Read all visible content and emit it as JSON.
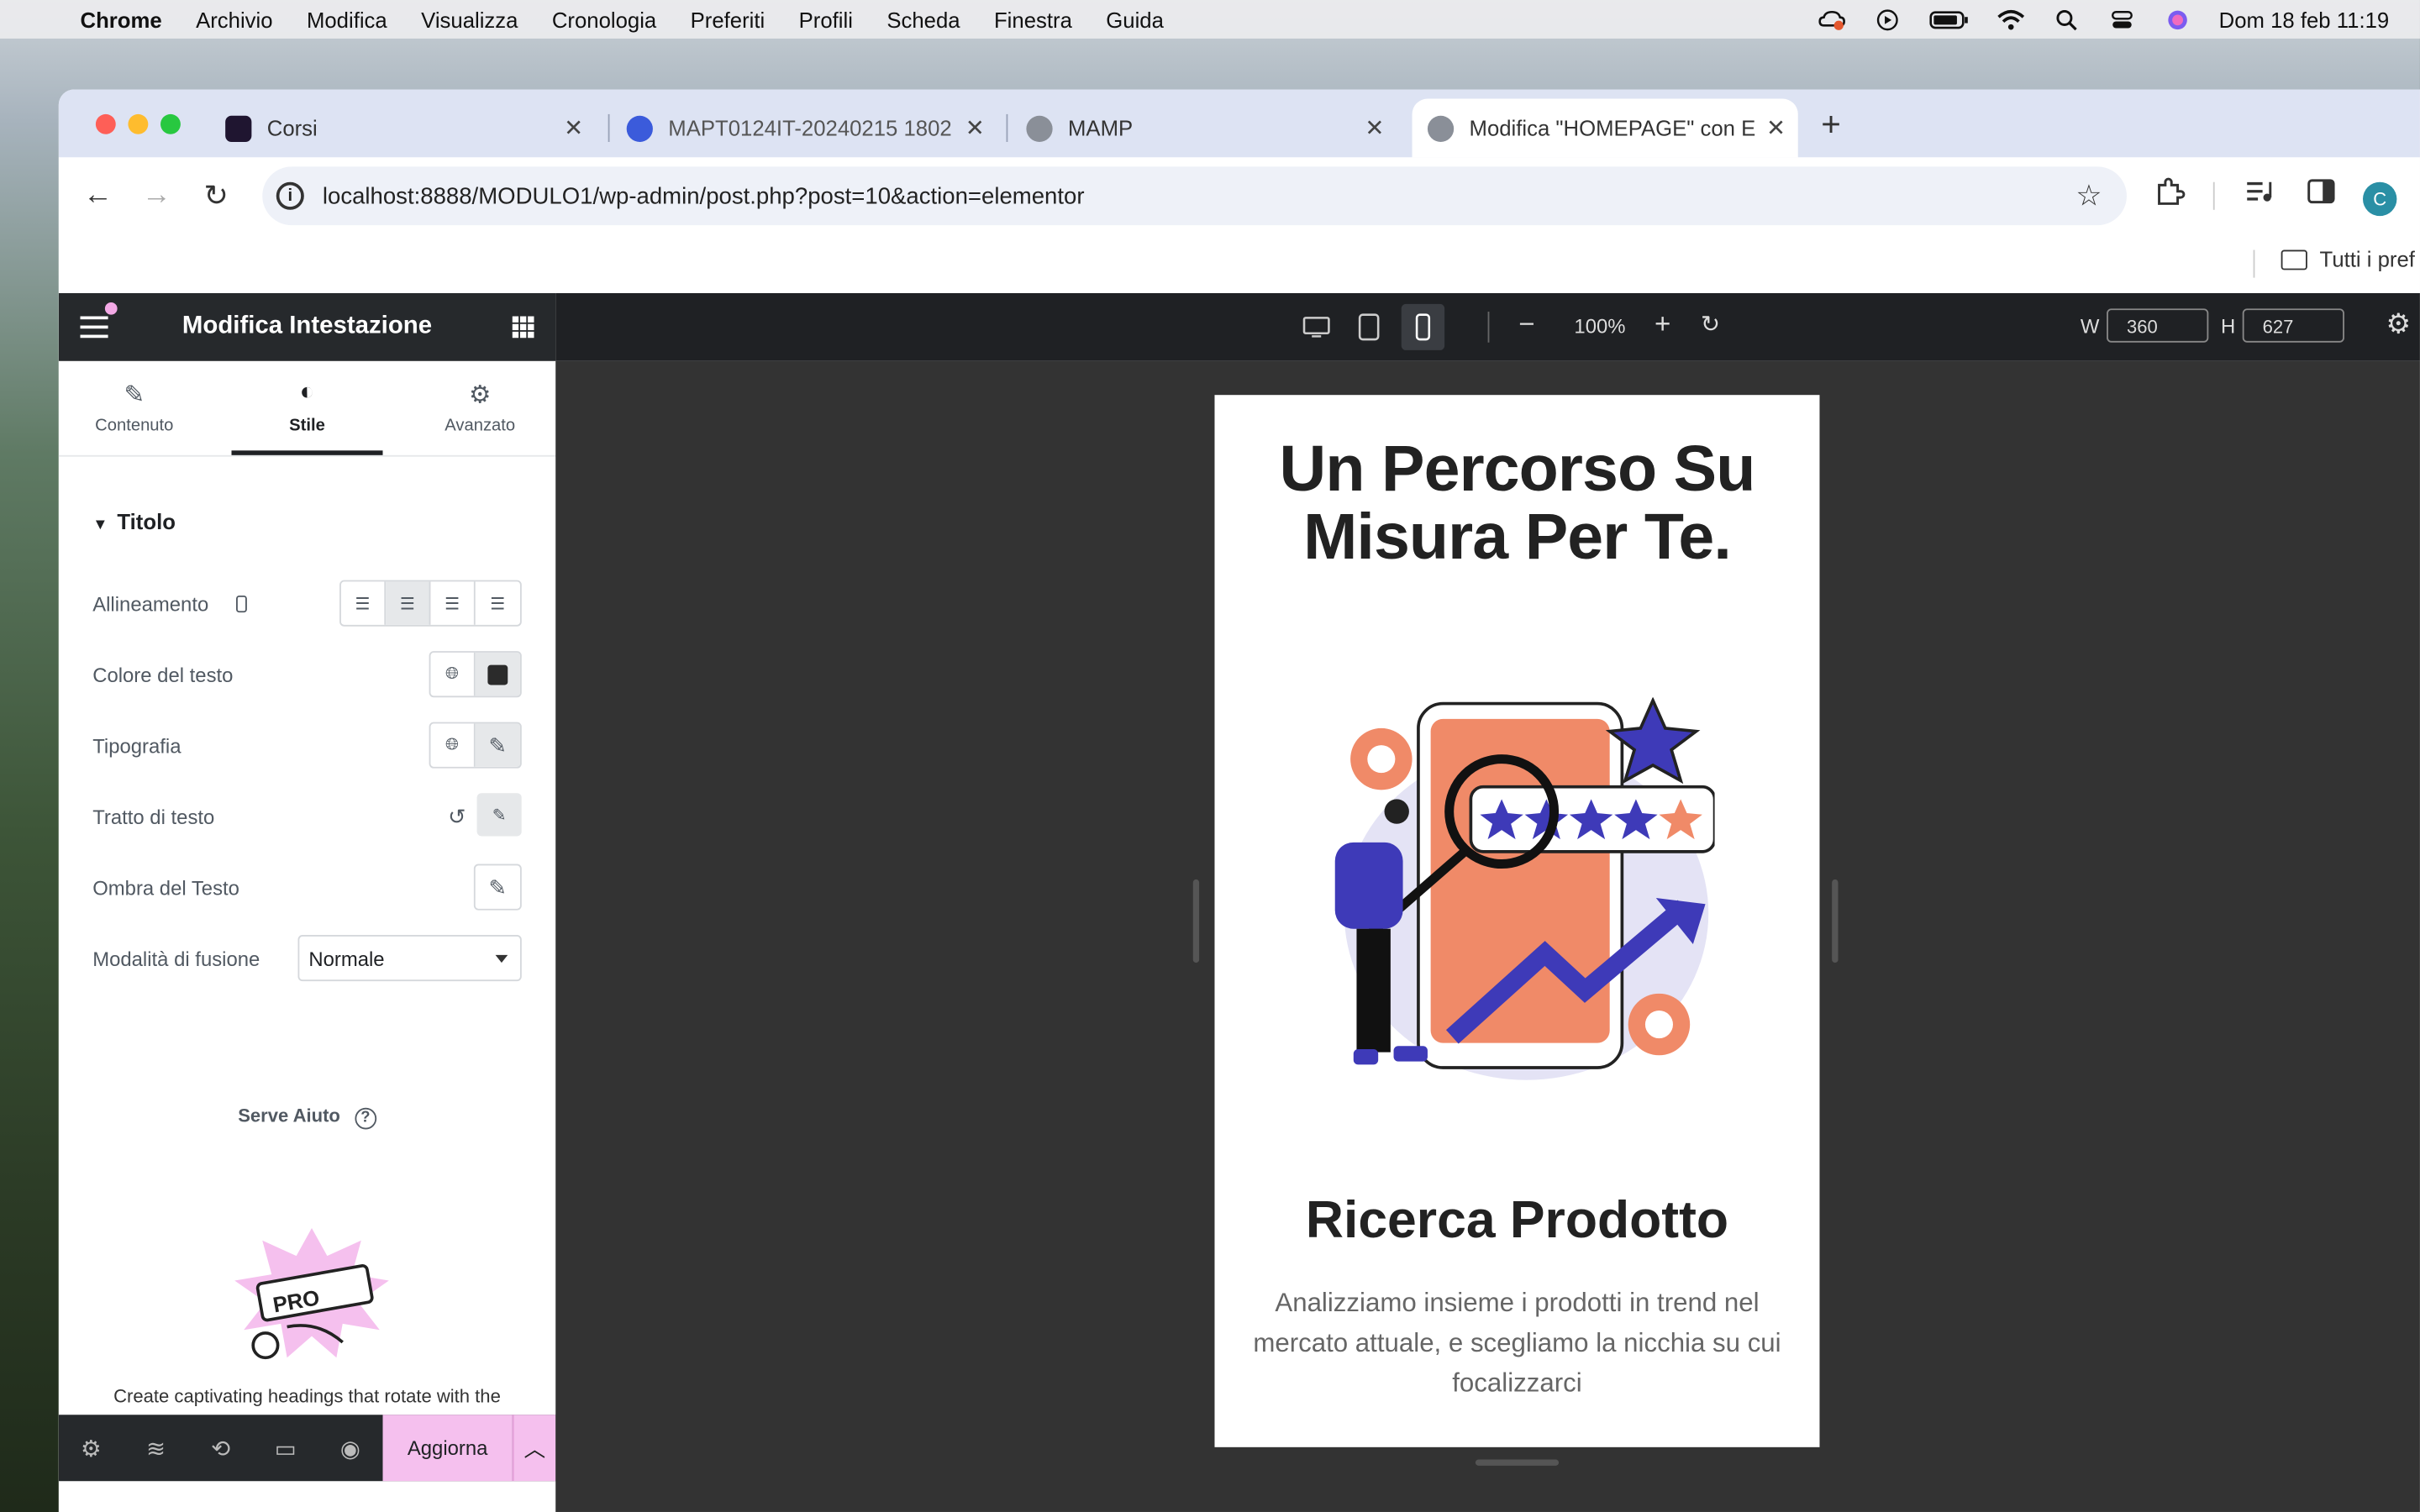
{
  "menubar": {
    "app": "Chrome",
    "items": [
      "Archivio",
      "Modifica",
      "Visualizza",
      "Cronologia",
      "Preferiti",
      "Profili",
      "Scheda",
      "Finestra",
      "Guida"
    ],
    "clock": "Dom 18 feb  11:19"
  },
  "tabs": [
    {
      "title": "Corsi",
      "favicon_color": "#1f1530"
    },
    {
      "title": "MAPT0124IT-20240215 1802",
      "favicon_color": "#3b5bdb"
    },
    {
      "title": "MAMP",
      "favicon_color": "#8a8f98"
    },
    {
      "title": "Modifica \"HOMEPAGE\" con E",
      "favicon_color": "#8a8f98"
    }
  ],
  "address": {
    "url": "localhost:8888/MODULO1/wp-admin/post.php?post=10&action=elementor"
  },
  "profile_initial": "C",
  "bookmarks": {
    "folder": "Tutti i pref"
  },
  "panel": {
    "title": "Modifica Intestazione",
    "tabs": [
      "Contenuto",
      "Stile",
      "Avanzato"
    ],
    "section": "Titolo",
    "rows": {
      "alignment": "Allineamento",
      "text_color": "Colore del testo",
      "typography": "Tipografia",
      "stroke": "Tratto di testo",
      "shadow": "Ombra del Testo",
      "blend": "Modalità di fusione"
    },
    "blend_value": "Normale",
    "help": "Serve Aiuto",
    "promo_label": "PRO",
    "promo": "Create captivating headings that rotate with the",
    "update": "Aggiorna"
  },
  "topbar": {
    "zoom": "100%",
    "w_label": "W",
    "w_value": "360",
    "h_label": "H",
    "h_value": "627"
  },
  "preview": {
    "hero": "Un Percorso Su Misura Per Te.",
    "heading": "Ricerca Prodotto",
    "paragraph": "Analizziamo insieme i prodotti in trend nel mercato attuale, e scegliamo la nicchia su cui focalizzarci"
  },
  "colors": {
    "accent": "#f5c0ee",
    "dark": "#26292c",
    "illustration_orange": "#f08a68",
    "illustration_blue": "#3e3ab8"
  }
}
